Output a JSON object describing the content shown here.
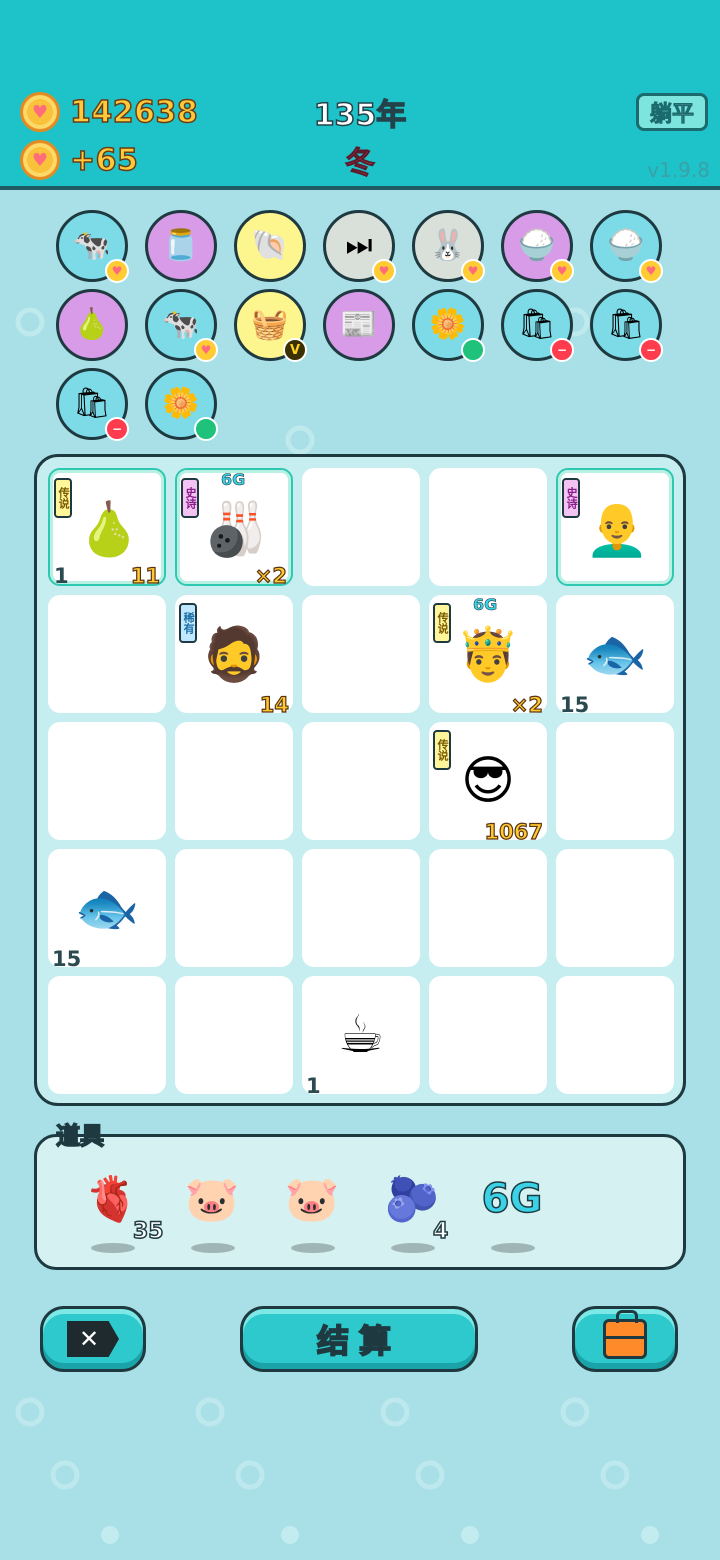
{
  "header": {
    "gold": "142638",
    "income": "+65",
    "year": "135年",
    "season": "冬",
    "flat_button": "躺平",
    "version": "v1.9.8"
  },
  "collection": [
    {
      "name": "cow-couple-icon",
      "bg": "#7ddbe8",
      "emoji": "🐄",
      "badge": "heart"
    },
    {
      "name": "jar-icon",
      "bg": "#d79be8",
      "emoji": "🫙",
      "badge": ""
    },
    {
      "name": "shell-icon",
      "bg": "#fdf58d",
      "emoji": "🐚",
      "badge": ""
    },
    {
      "name": "skip-icon",
      "bg": "#d9dfd9",
      "emoji": "⏭",
      "badge": "heart"
    },
    {
      "name": "rabbit-icon",
      "bg": "#d9dfd9",
      "emoji": "🐰",
      "badge": "heart"
    },
    {
      "name": "rice-bowl-icon",
      "bg": "#d79be8",
      "emoji": "🍚",
      "badge": "heart"
    },
    {
      "name": "rice-bowl-icon",
      "bg": "#7ddbe8",
      "emoji": "🍚",
      "badge": "heart"
    },
    {
      "name": "pear-icon",
      "bg": "#d79be8",
      "emoji": "🍐",
      "badge": ""
    },
    {
      "name": "cow-couple-icon",
      "bg": "#7ddbe8",
      "emoji": "🐄",
      "badge": "heart"
    },
    {
      "name": "fruit-basket-icon",
      "bg": "#fdf58d",
      "emoji": "🧺",
      "badge": "v"
    },
    {
      "name": "time-magazine-icon",
      "bg": "#d79be8",
      "emoji": "📰",
      "badge": ""
    },
    {
      "name": "flower-pot-icon",
      "bg": "#7ddbe8",
      "emoji": "🌼",
      "badge": "green"
    },
    {
      "name": "rice-sack-icon",
      "bg": "#7ddbe8",
      "emoji": "🛍",
      "badge": "minus"
    },
    {
      "name": "rice-sack-icon",
      "bg": "#7ddbe8",
      "emoji": "🛍",
      "badge": "minus"
    },
    {
      "name": "rice-sack-icon",
      "bg": "#7ddbe8",
      "emoji": "🛍",
      "badge": "minus"
    },
    {
      "name": "flower-pot-icon",
      "bg": "#7ddbe8",
      "emoji": "🌼",
      "badge": "green"
    }
  ],
  "board": {
    "cells": [
      {
        "name": "pear-cell",
        "emoji": "🍐",
        "tag": "传说",
        "tagtype": "legend",
        "count_left": "1",
        "count_right": "11",
        "hl": true
      },
      {
        "name": "kart-rider-cell",
        "emoji": "🎳",
        "tag": "史诗",
        "tagtype": "epic",
        "count_right": "×2",
        "hl": true,
        "sixg": true
      },
      {
        "name": "empty-cell"
      },
      {
        "name": "empty-cell"
      },
      {
        "name": "masked-man-cell",
        "emoji": "👨‍🦲",
        "tag": "史诗",
        "tagtype": "epic",
        "hl": true
      },
      {
        "name": "empty-cell"
      },
      {
        "name": "bucket-hat-man-cell",
        "emoji": "🧔",
        "tag": "稀有",
        "tagtype": "rare",
        "count_right": "14"
      },
      {
        "name": "empty-cell"
      },
      {
        "name": "crowned-man-cell",
        "emoji": "🤴",
        "tag": "传说",
        "tagtype": "legend",
        "count_right": "×2",
        "sixg": true
      },
      {
        "name": "fish-cell",
        "emoji": "🐟",
        "count_left": "15"
      },
      {
        "name": "empty-cell"
      },
      {
        "name": "empty-cell"
      },
      {
        "name": "empty-cell"
      },
      {
        "name": "sunglasses-man-cell",
        "emoji": "😎",
        "tag": "传说",
        "tagtype": "legend",
        "count_right": "1067"
      },
      {
        "name": "empty-cell"
      },
      {
        "name": "fish-cell",
        "emoji": "🐟",
        "count_left": "15"
      },
      {
        "name": "empty-cell"
      },
      {
        "name": "empty-cell"
      },
      {
        "name": "empty-cell"
      },
      {
        "name": "empty-cell"
      },
      {
        "name": "empty-cell"
      },
      {
        "name": "empty-cell"
      },
      {
        "name": "coffee-cell",
        "emoji": "☕",
        "count_left": "1"
      },
      {
        "name": "empty-cell"
      },
      {
        "name": "empty-cell"
      }
    ],
    "sixg_label": "6G"
  },
  "items": {
    "title": "道具",
    "list": [
      {
        "name": "liver-icon",
        "emoji": "🫀",
        "count": "35"
      },
      {
        "name": "piggy-bank-icon",
        "emoji": "🐷",
        "count": ""
      },
      {
        "name": "piggy-bank-icon",
        "emoji": "🐷",
        "count": ""
      },
      {
        "name": "blueberry-icon",
        "emoji": "🫐",
        "count": "4"
      },
      {
        "name": "6g-icon",
        "text": "6G",
        "count": ""
      }
    ]
  },
  "buttons": {
    "settle": "结算"
  },
  "colors": {
    "header_bg": "#1ec3c9",
    "page_bg": "#a9dfe6",
    "gold_text": "#ffc93a",
    "winter_text": "#ff4f6c"
  }
}
